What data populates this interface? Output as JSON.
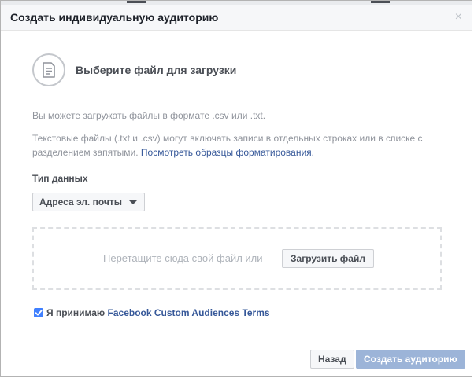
{
  "dialog": {
    "title": "Создать индивидуальную аудиторию",
    "close_glyph": "×"
  },
  "upload_section": {
    "title": "Выберите файл для загрузки",
    "icon": "file-document-icon",
    "info_formats": "Вы можете загружать файлы в формате .csv или .txt.",
    "info_structure": "Текстовые файлы (.txt и .csv) могут включать записи в отдельных строках или в списке с разделением запятыми. ",
    "formatting_link": "Посмотреть образцы форматирования."
  },
  "data_type": {
    "label": "Тип данных",
    "selected": "Адреса эл. почты"
  },
  "drop_zone": {
    "text": "Перетащите сюда свой файл или",
    "upload_label": "Загрузить файл"
  },
  "terms": {
    "checked": true,
    "prefix": "Я принимаю ",
    "link": "Facebook Custom Audiences Terms"
  },
  "footer": {
    "back_label": "Назад",
    "create_label": "Создать аудиторию"
  },
  "colors": {
    "link": "#365899",
    "checkbox": "#4080ff",
    "create_button_disabled": "#9cb4d8",
    "header_bg": "#f6f7f9"
  }
}
